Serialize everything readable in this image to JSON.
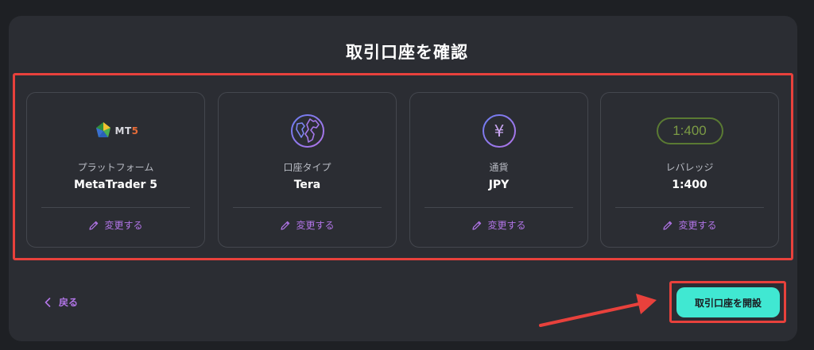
{
  "page": {
    "title": "取引口座を確認"
  },
  "cards": [
    {
      "icon": "mt5-logo-icon",
      "logo_text": "MT",
      "logo_num": "5",
      "label": "プラットフォーム",
      "value": "MetaTrader 5",
      "change_label": "変更する"
    },
    {
      "icon": "globe-icon",
      "label": "口座タイプ",
      "value": "Tera",
      "change_label": "変更する"
    },
    {
      "icon": "yen-circle-icon",
      "icon_text": "¥",
      "label": "通貨",
      "value": "JPY",
      "change_label": "変更する"
    },
    {
      "icon": "leverage-badge-icon",
      "icon_text": "1:400",
      "label": "レバレッジ",
      "value": "1:400",
      "change_label": "変更する"
    }
  ],
  "footer": {
    "back_label": "戻る",
    "open_account_label": "取引口座を開設"
  },
  "colors": {
    "accent_purple": "#b275e8",
    "cta_teal": "#40e8d2",
    "highlight_red": "#e8413c"
  }
}
